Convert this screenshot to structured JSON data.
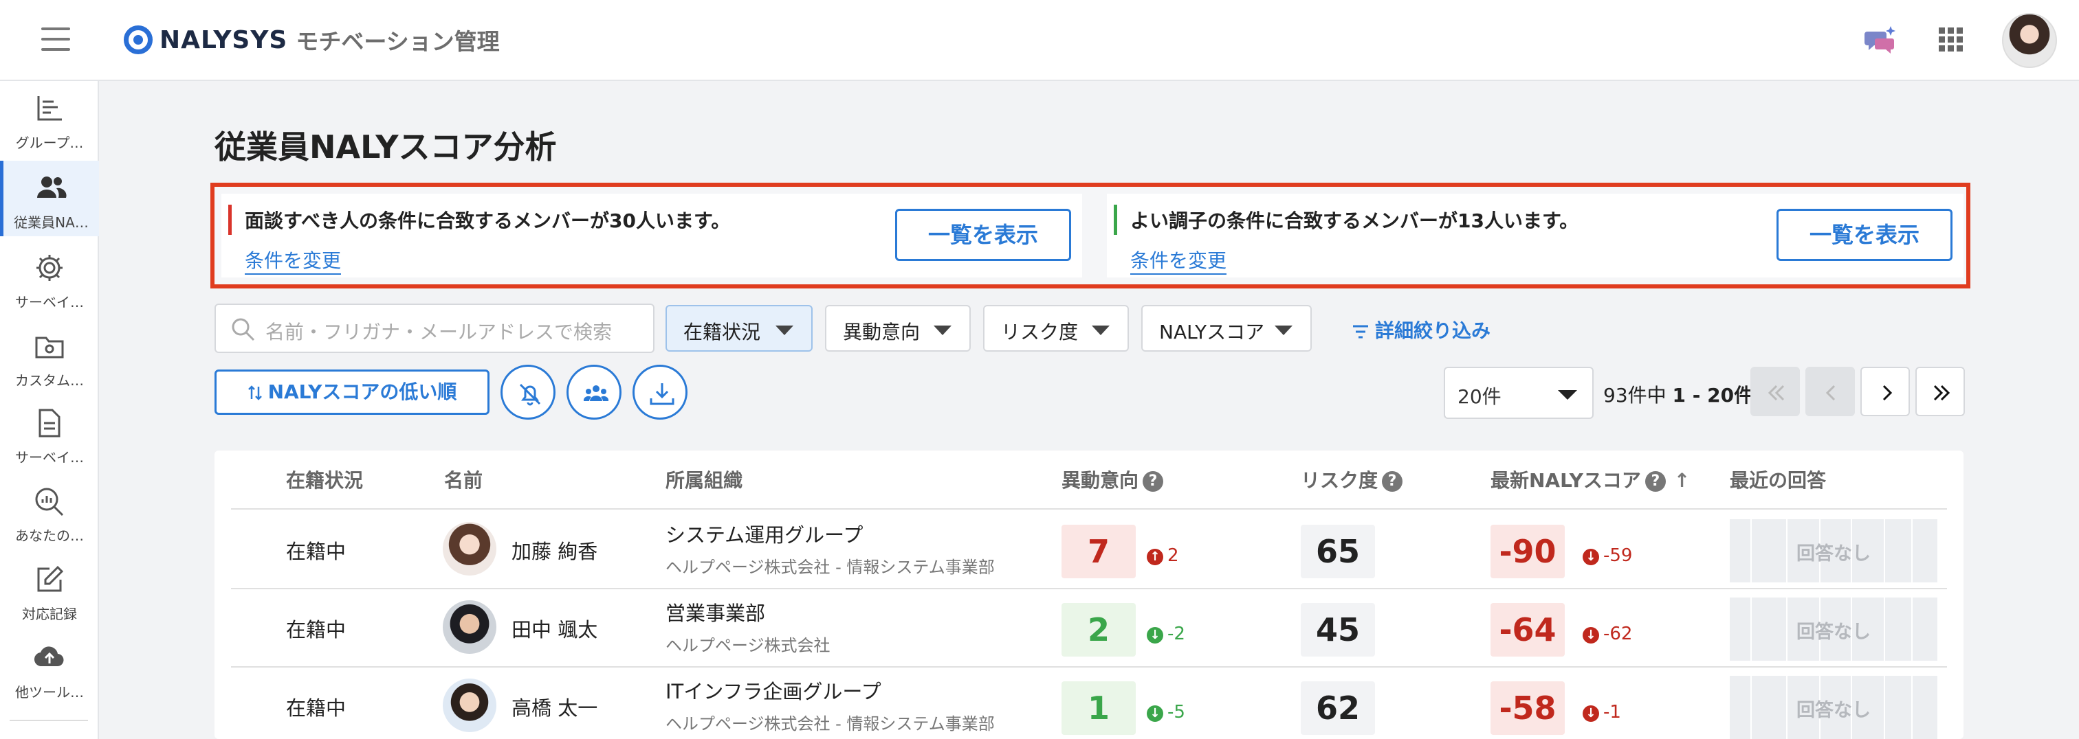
{
  "header": {
    "brand": "NALYSYS",
    "subtitle": "モチベーション管理",
    "icons": [
      "menu-icon",
      "chat-sparkle-icon",
      "apps-grid-icon",
      "user-avatar"
    ]
  },
  "sidebar": {
    "items": [
      {
        "label": "グループ…",
        "icon": "bar-chart-icon"
      },
      {
        "label": "従業員NA…",
        "icon": "people-icon"
      },
      {
        "label": "サーベイ…",
        "icon": "gear-icon"
      },
      {
        "label": "カスタム…",
        "icon": "folder-gear-icon"
      },
      {
        "label": "サーベイ…",
        "icon": "document-icon"
      },
      {
        "label": "あなたの…",
        "icon": "search-chart-icon"
      },
      {
        "label": "対応記録",
        "icon": "edit-icon"
      },
      {
        "label": "他ツール…",
        "icon": "cloud-upload-icon"
      }
    ]
  },
  "page": {
    "title": "従業員NALYスコア分析"
  },
  "alerts": [
    {
      "message": "面談すべき人の条件に合致するメンバーが30人います。",
      "link": "条件を変更",
      "button": "一覧を表示",
      "color": "#d9342b"
    },
    {
      "message": "よい調子の条件に合致するメンバーが13人います。",
      "link": "条件を変更",
      "button": "一覧を表示",
      "color": "#3aa64a"
    }
  ],
  "filters": {
    "search_placeholder": "名前・フリガナ・メールアドレスで検索",
    "buttons": [
      "在籍状況",
      "異動意向",
      "リスク度",
      "NALYスコア"
    ],
    "detail": "詳細絞り込み",
    "sort": "NALYスコアの低い順"
  },
  "pagination": {
    "per_page": "20件",
    "summary_prefix": "93件中",
    "summary_range": "1 - 20件"
  },
  "table": {
    "headers": {
      "status": "在籍状況",
      "name": "名前",
      "org": "所属組織",
      "transfer": "異動意向",
      "risk": "リスク度",
      "score": "最新NALYスコア",
      "recent": "最近の回答"
    },
    "rows": [
      {
        "status": "在籍中",
        "name": "加藤 絢香",
        "org": "システム運用グループ",
        "org_sub": "ヘルプページ株式会社 - 情報システム事業部",
        "transfer": "7",
        "transfer_delta": "2",
        "risk": "65",
        "score": "-90",
        "score_delta": "-59",
        "recent": "回答なし"
      },
      {
        "status": "在籍中",
        "name": "田中 颯太",
        "org": "営業事業部",
        "org_sub": "ヘルプページ株式会社",
        "transfer": "2",
        "transfer_delta": "-2",
        "risk": "45",
        "score": "-64",
        "score_delta": "-62",
        "recent": "回答なし"
      },
      {
        "status": "在籍中",
        "name": "高橋 太一",
        "org": "ITインフラ企画グループ",
        "org_sub": "ヘルプページ株式会社 - 情報システム事業部",
        "transfer": "1",
        "transfer_delta": "-5",
        "risk": "62",
        "score": "-58",
        "score_delta": "-1",
        "recent": "回答なし"
      }
    ]
  },
  "colors": {
    "accent": "#2a7ad6",
    "alert_border": "#e03c1f",
    "bad": "#c0281d",
    "good": "#3aa64a"
  }
}
